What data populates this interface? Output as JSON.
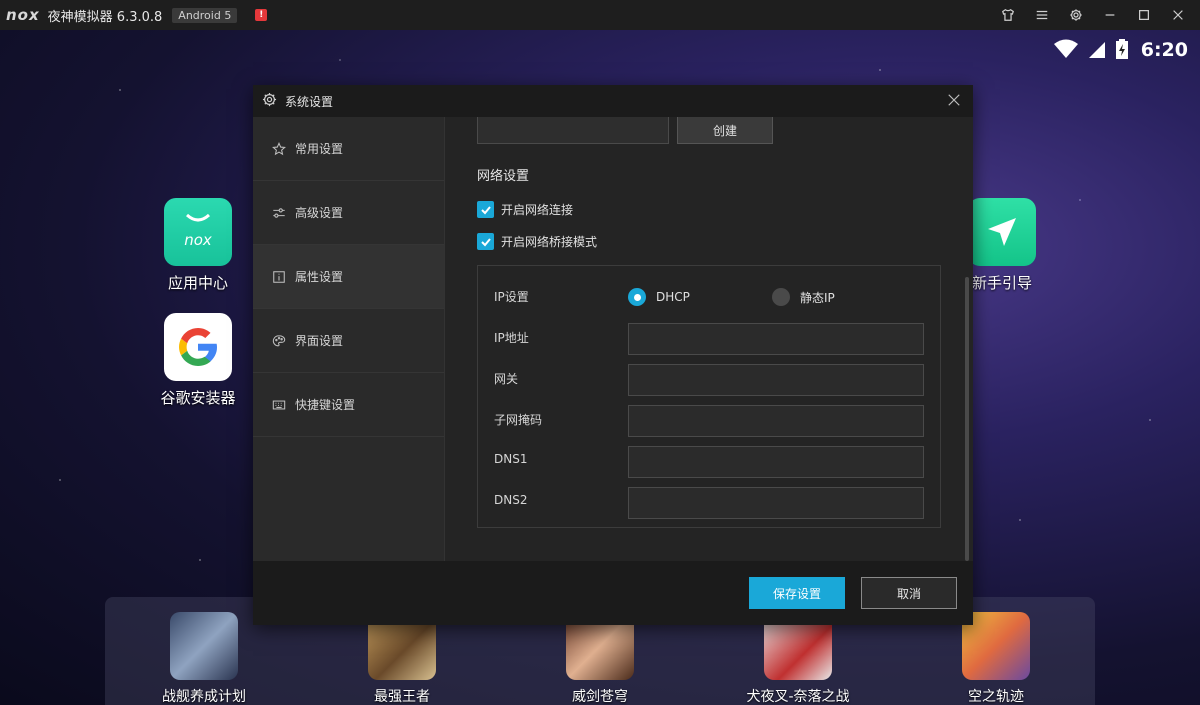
{
  "titlebar": {
    "logo": "nox",
    "app_title": "夜神模拟器 6.3.0.8",
    "android_badge": "Android 5",
    "alert_badge": "!"
  },
  "statusbar": {
    "time": "6:20"
  },
  "desktop": {
    "apps": [
      {
        "label": "应用中心"
      },
      {
        "label": "谷歌安装器"
      },
      {
        "label": "新手引导"
      }
    ]
  },
  "dock": {
    "apps": [
      {
        "label": "战舰养成计划"
      },
      {
        "label": "最强王者"
      },
      {
        "label": "威剑苍穹"
      },
      {
        "label": "犬夜叉-奈落之战"
      },
      {
        "label": "空之轨迹"
      }
    ]
  },
  "dialog": {
    "title": "系统设置",
    "sidebar": [
      {
        "label": "常用设置"
      },
      {
        "label": "高级设置"
      },
      {
        "label": "属性设置"
      },
      {
        "label": "界面设置"
      },
      {
        "label": "快捷键设置"
      }
    ],
    "active_index": 2,
    "create_label": "创建",
    "network_section": "网络设置",
    "checkboxes": [
      {
        "label": "开启网络连接",
        "checked": true
      },
      {
        "label": "开启网络桥接模式",
        "checked": true
      }
    ],
    "ip": {
      "setting_label": "IP设置",
      "dhcp_label": "DHCP",
      "static_label": "静态IP",
      "selected": "DHCP",
      "fields": [
        {
          "label": "IP地址",
          "value": ""
        },
        {
          "label": "网关",
          "value": ""
        },
        {
          "label": "子网掩码",
          "value": ""
        },
        {
          "label": "DNS1",
          "value": ""
        },
        {
          "label": "DNS2",
          "value": ""
        }
      ]
    },
    "save_label": "保存设置",
    "cancel_label": "取消"
  },
  "colors": {
    "accent": "#1aa8d8",
    "dialog_bg": "#242424",
    "header_bg": "#1b1b1b"
  }
}
